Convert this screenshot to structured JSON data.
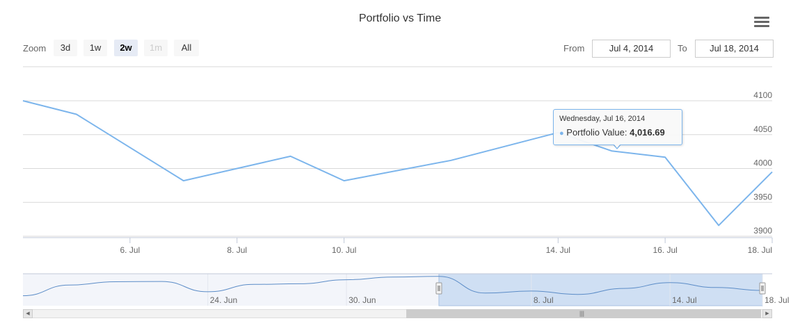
{
  "title": "Portfolio vs Time",
  "menu_icon": "hamburger-menu-icon",
  "zoom": {
    "label": "Zoom",
    "buttons": [
      {
        "label": "3d",
        "state": "normal"
      },
      {
        "label": "1w",
        "state": "normal"
      },
      {
        "label": "2w",
        "state": "active"
      },
      {
        "label": "1m",
        "state": "disabled"
      },
      {
        "label": "All",
        "state": "normal"
      }
    ]
  },
  "range": {
    "from_label": "From",
    "from_value": "Jul 4, 2014",
    "to_label": "To",
    "to_value": "Jul 18, 2014"
  },
  "tooltip": {
    "date": "Wednesday, Jul 16, 2014",
    "series_label": "Portfolio Value",
    "value": "4,016.69"
  },
  "colors": {
    "series": "#7cb5ec",
    "navigator_mask": "#cfdff3",
    "gridline": "#d8d8d8",
    "axis_text": "#666666"
  },
  "chart_data": {
    "type": "line",
    "title": "Portfolio vs Time",
    "series": [
      {
        "name": "Portfolio Value",
        "x": [
          "2014-07-04",
          "2014-07-05",
          "2014-07-07",
          "2014-07-09",
          "2014-07-10",
          "2014-07-12",
          "2014-07-14",
          "2014-07-15",
          "2014-07-16",
          "2014-07-17",
          "2014-07-18"
        ],
        "y": [
          4100,
          4080,
          3982,
          4018,
          3982,
          4012,
          4053,
          4026,
          4016.69,
          3916,
          3995
        ]
      }
    ],
    "x_ticks": [
      "6. Jul",
      "8. Jul",
      "10. Jul",
      "14. Jul",
      "16. Jul",
      "18. Jul"
    ],
    "x_tick_dates": [
      "2014-07-06",
      "2014-07-08",
      "2014-07-10",
      "2014-07-14",
      "2014-07-16",
      "2014-07-18"
    ],
    "y_ticks": [
      3900,
      3950,
      4000,
      4050,
      4100
    ],
    "ylim": [
      3900,
      4100
    ],
    "xlim": [
      "2014-07-04",
      "2014-07-18"
    ],
    "grid": true,
    "y_axis_side": "right",
    "navigator": {
      "labels": [
        "24. Jun",
        "30. Jun",
        "8. Jul",
        "14. Jul",
        "18. Jul"
      ],
      "label_dates": [
        "2014-06-24",
        "2014-06-30",
        "2014-07-08",
        "2014-07-14",
        "2014-07-18"
      ],
      "range": [
        "2014-06-16",
        "2014-07-18"
      ],
      "selected": [
        "2014-07-04",
        "2014-07-18"
      ],
      "ylim": [
        3880,
        4120
      ],
      "x": [
        "2014-06-16",
        "2014-06-18",
        "2014-06-20",
        "2014-06-22",
        "2014-06-24",
        "2014-06-26",
        "2014-06-28",
        "2014-06-30",
        "2014-07-02",
        "2014-07-04",
        "2014-07-06",
        "2014-07-08",
        "2014-07-10",
        "2014-07-12",
        "2014-07-14",
        "2014-07-16",
        "2014-07-18"
      ],
      "y": [
        3955,
        4035,
        4060,
        4062,
        3985,
        4040,
        4045,
        4075,
        4095,
        4100,
        3975,
        3990,
        3965,
        4010,
        4053,
        4016.69,
        3995
      ]
    }
  }
}
